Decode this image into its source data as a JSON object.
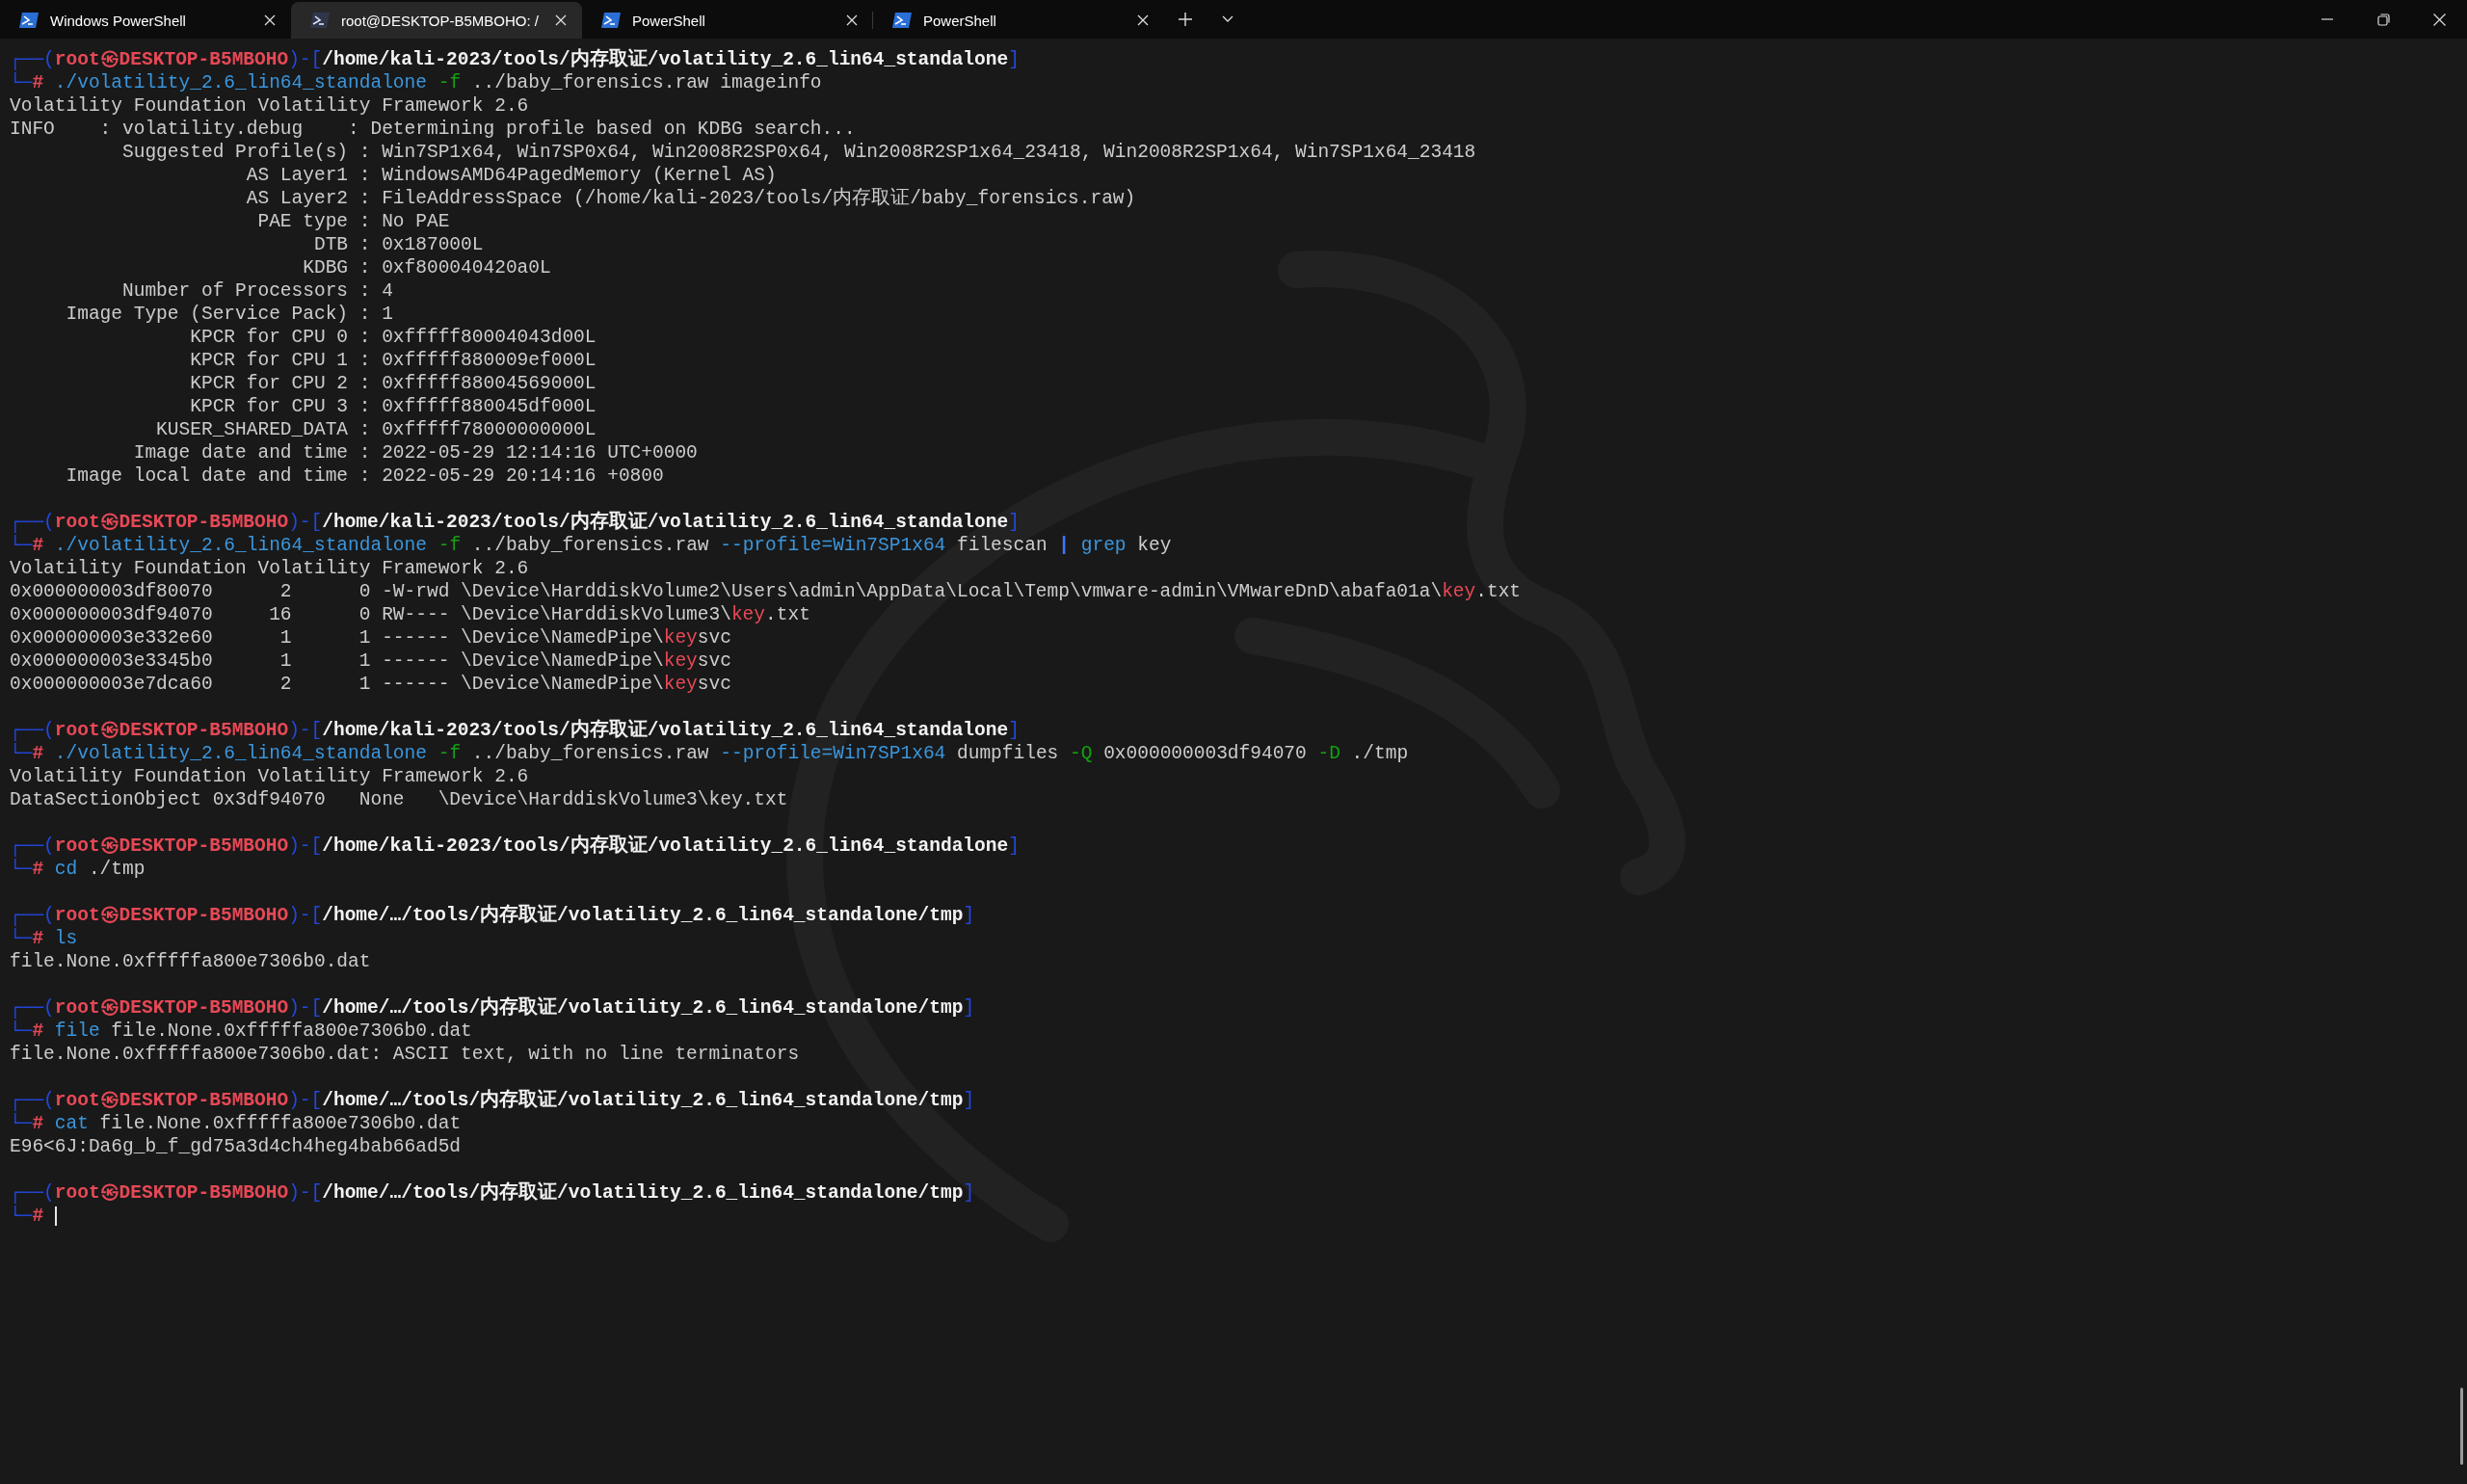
{
  "tabs": [
    {
      "title": "Windows PowerShell",
      "kind": "powershell",
      "selected": false
    },
    {
      "title": "root@DESKTOP-B5MBOHO: /",
      "kind": "terminal",
      "selected": true
    },
    {
      "title": "PowerShell",
      "kind": "powershell",
      "selected": false
    },
    {
      "title": "PowerShell",
      "kind": "powershell",
      "selected": false
    }
  ],
  "terminal": {
    "lines": [
      {
        "segments": [
          {
            "text": "┌──(",
            "kind": "frame"
          },
          {
            "text": "root㉿DESKTOP-B5MBOHO",
            "kind": "user"
          },
          {
            "text": ")-[",
            "kind": "frame"
          },
          {
            "text": "/home/kali-2023/tools/内存取证/volatility_2.6_lin64_standalone",
            "kind": "path"
          },
          {
            "text": "]",
            "kind": "frame"
          }
        ]
      },
      {
        "segments": [
          {
            "text": "└─",
            "kind": "frame"
          },
          {
            "text": "#",
            "kind": "user"
          },
          {
            "text": " ./volatility_2.6_lin64_standalone",
            "kind": "command"
          },
          {
            "text": " -f",
            "kind": "option"
          },
          {
            "text": " ../baby_forensics.raw imageinfo",
            "kind": "plain"
          }
        ]
      },
      {
        "segments": [
          {
            "text": "Volatility Foundation Volatility Framework 2.6",
            "kind": "plain"
          }
        ]
      },
      {
        "segments": [
          {
            "text": "INFO    : volatility.debug    : Determining profile based on KDBG search...",
            "kind": "plain"
          }
        ]
      },
      {
        "segments": [
          {
            "text": "          Suggested Profile(s) : Win7SP1x64, Win7SP0x64, Win2008R2SP0x64, Win2008R2SP1x64_23418, Win2008R2SP1x64, Win7SP1x64_23418",
            "kind": "plain"
          }
        ]
      },
      {
        "segments": [
          {
            "text": "                     AS Layer1 : WindowsAMD64PagedMemory (Kernel AS)",
            "kind": "plain"
          }
        ]
      },
      {
        "segments": [
          {
            "text": "                     AS Layer2 : FileAddressSpace (/home/kali-2023/tools/内存取证/baby_forensics.raw)",
            "kind": "plain"
          }
        ]
      },
      {
        "segments": [
          {
            "text": "                      PAE type : No PAE",
            "kind": "plain"
          }
        ]
      },
      {
        "segments": [
          {
            "text": "                           DTB : 0x187000L",
            "kind": "plain"
          }
        ]
      },
      {
        "segments": [
          {
            "text": "                          KDBG : 0xf800040420a0L",
            "kind": "plain"
          }
        ]
      },
      {
        "segments": [
          {
            "text": "          Number of Processors : 4",
            "kind": "plain"
          }
        ]
      },
      {
        "segments": [
          {
            "text": "     Image Type (Service Pack) : 1",
            "kind": "plain"
          }
        ]
      },
      {
        "segments": [
          {
            "text": "                KPCR for CPU 0 : 0xfffff80004043d00L",
            "kind": "plain"
          }
        ]
      },
      {
        "segments": [
          {
            "text": "                KPCR for CPU 1 : 0xfffff880009ef000L",
            "kind": "plain"
          }
        ]
      },
      {
        "segments": [
          {
            "text": "                KPCR for CPU 2 : 0xfffff88004569000L",
            "kind": "plain"
          }
        ]
      },
      {
        "segments": [
          {
            "text": "                KPCR for CPU 3 : 0xfffff880045df000L",
            "kind": "plain"
          }
        ]
      },
      {
        "segments": [
          {
            "text": "             KUSER_SHARED_DATA : 0xfffff78000000000L",
            "kind": "plain"
          }
        ]
      },
      {
        "segments": [
          {
            "text": "           Image date and time : 2022-05-29 12:14:16 UTC+0000",
            "kind": "plain"
          }
        ]
      },
      {
        "segments": [
          {
            "text": "     Image local date and time : 2022-05-29 20:14:16 +0800",
            "kind": "plain"
          }
        ]
      },
      {
        "blank_before": true,
        "segments": [
          {
            "text": "┌──(",
            "kind": "frame"
          },
          {
            "text": "root㉿DESKTOP-B5MBOHO",
            "kind": "user"
          },
          {
            "text": ")-[",
            "kind": "frame"
          },
          {
            "text": "/home/kali-2023/tools/内存取证/volatility_2.6_lin64_standalone",
            "kind": "path"
          },
          {
            "text": "]",
            "kind": "frame"
          }
        ]
      },
      {
        "segments": [
          {
            "text": "└─",
            "kind": "frame"
          },
          {
            "text": "#",
            "kind": "user"
          },
          {
            "text": " ./volatility_2.6_lin64_standalone",
            "kind": "command"
          },
          {
            "text": " -f",
            "kind": "option"
          },
          {
            "text": " ../baby_forensics.raw ",
            "kind": "plain"
          },
          {
            "text": "--profile=Win7SP1x64",
            "kind": "command"
          },
          {
            "text": " filescan ",
            "kind": "plain"
          },
          {
            "text": "|",
            "kind": "pipe"
          },
          {
            "text": " grep",
            "kind": "command"
          },
          {
            "text": " key",
            "kind": "plain"
          }
        ]
      },
      {
        "segments": [
          {
            "text": "Volatility Foundation Volatility Framework 2.6",
            "kind": "plain"
          }
        ]
      },
      {
        "segments": [
          {
            "text": "0x000000003df80070      2      0 -W-rwd \\Device\\HarddiskVolume2\\Users\\admin\\AppData\\Local\\Temp\\vmware-admin\\VMwareDnD\\abafa01a\\",
            "kind": "plain"
          },
          {
            "text": "key",
            "kind": "match"
          },
          {
            "text": ".txt",
            "kind": "plain"
          }
        ]
      },
      {
        "segments": [
          {
            "text": "0x000000003df94070     16      0 RW---- \\Device\\HarddiskVolume3\\",
            "kind": "plain"
          },
          {
            "text": "key",
            "kind": "match"
          },
          {
            "text": ".txt",
            "kind": "plain"
          }
        ]
      },
      {
        "segments": [
          {
            "text": "0x000000003e332e60      1      1 ------ \\Device\\NamedPipe\\",
            "kind": "plain"
          },
          {
            "text": "key",
            "kind": "match"
          },
          {
            "text": "svc",
            "kind": "plain"
          }
        ]
      },
      {
        "segments": [
          {
            "text": "0x000000003e3345b0      1      1 ------ \\Device\\NamedPipe\\",
            "kind": "plain"
          },
          {
            "text": "key",
            "kind": "match"
          },
          {
            "text": "svc",
            "kind": "plain"
          }
        ]
      },
      {
        "segments": [
          {
            "text": "0x000000003e7dca60      2      1 ------ \\Device\\NamedPipe\\",
            "kind": "plain"
          },
          {
            "text": "key",
            "kind": "match"
          },
          {
            "text": "svc",
            "kind": "plain"
          }
        ]
      },
      {
        "blank_before": true,
        "segments": [
          {
            "text": "┌──(",
            "kind": "frame"
          },
          {
            "text": "root㉿DESKTOP-B5MBOHO",
            "kind": "user"
          },
          {
            "text": ")-[",
            "kind": "frame"
          },
          {
            "text": "/home/kali-2023/tools/内存取证/volatility_2.6_lin64_standalone",
            "kind": "path"
          },
          {
            "text": "]",
            "kind": "frame"
          }
        ]
      },
      {
        "segments": [
          {
            "text": "└─",
            "kind": "frame"
          },
          {
            "text": "#",
            "kind": "user"
          },
          {
            "text": " ./volatility_2.6_lin64_standalone",
            "kind": "command"
          },
          {
            "text": " -f",
            "kind": "option"
          },
          {
            "text": " ../baby_forensics.raw ",
            "kind": "plain"
          },
          {
            "text": "--profile=Win7SP1x64",
            "kind": "command"
          },
          {
            "text": " dumpfiles ",
            "kind": "plain"
          },
          {
            "text": "-Q",
            "kind": "option"
          },
          {
            "text": " 0x000000003df94070 ",
            "kind": "plain"
          },
          {
            "text": "-D",
            "kind": "option"
          },
          {
            "text": " ./tmp",
            "kind": "plain"
          }
        ]
      },
      {
        "segments": [
          {
            "text": "Volatility Foundation Volatility Framework 2.6",
            "kind": "plain"
          }
        ]
      },
      {
        "segments": [
          {
            "text": "DataSectionObject 0x3df94070   None   \\Device\\HarddiskVolume3\\key.txt",
            "kind": "plain"
          }
        ]
      },
      {
        "blank_before": true,
        "segments": [
          {
            "text": "┌──(",
            "kind": "frame"
          },
          {
            "text": "root㉿DESKTOP-B5MBOHO",
            "kind": "user"
          },
          {
            "text": ")-[",
            "kind": "frame"
          },
          {
            "text": "/home/kali-2023/tools/内存取证/volatility_2.6_lin64_standalone",
            "kind": "path"
          },
          {
            "text": "]",
            "kind": "frame"
          }
        ]
      },
      {
        "segments": [
          {
            "text": "└─",
            "kind": "frame"
          },
          {
            "text": "#",
            "kind": "user"
          },
          {
            "text": " cd",
            "kind": "command"
          },
          {
            "text": " ./tmp",
            "kind": "plain"
          }
        ]
      },
      {
        "blank_before": true,
        "segments": [
          {
            "text": "┌──(",
            "kind": "frame"
          },
          {
            "text": "root㉿DESKTOP-B5MBOHO",
            "kind": "user"
          },
          {
            "text": ")-[",
            "kind": "frame"
          },
          {
            "text": "/home/…/tools/内存取证/volatility_2.6_lin64_standalone/tmp",
            "kind": "path"
          },
          {
            "text": "]",
            "kind": "frame"
          }
        ]
      },
      {
        "segments": [
          {
            "text": "└─",
            "kind": "frame"
          },
          {
            "text": "#",
            "kind": "user"
          },
          {
            "text": " ls",
            "kind": "command"
          }
        ]
      },
      {
        "segments": [
          {
            "text": "file.None.0xfffffa800e7306b0.dat",
            "kind": "plain"
          }
        ]
      },
      {
        "blank_before": true,
        "segments": [
          {
            "text": "┌──(",
            "kind": "frame"
          },
          {
            "text": "root㉿DESKTOP-B5MBOHO",
            "kind": "user"
          },
          {
            "text": ")-[",
            "kind": "frame"
          },
          {
            "text": "/home/…/tools/内存取证/volatility_2.6_lin64_standalone/tmp",
            "kind": "path"
          },
          {
            "text": "]",
            "kind": "frame"
          }
        ]
      },
      {
        "segments": [
          {
            "text": "└─",
            "kind": "frame"
          },
          {
            "text": "#",
            "kind": "user"
          },
          {
            "text": " file",
            "kind": "command"
          },
          {
            "text": " file.None.0xfffffa800e7306b0.dat",
            "kind": "plain"
          }
        ]
      },
      {
        "segments": [
          {
            "text": "file.None.0xfffffa800e7306b0.dat: ASCII text, with no line terminators",
            "kind": "plain"
          }
        ]
      },
      {
        "blank_before": true,
        "segments": [
          {
            "text": "┌──(",
            "kind": "frame"
          },
          {
            "text": "root㉿DESKTOP-B5MBOHO",
            "kind": "user"
          },
          {
            "text": ")-[",
            "kind": "frame"
          },
          {
            "text": "/home/…/tools/内存取证/volatility_2.6_lin64_standalone/tmp",
            "kind": "path"
          },
          {
            "text": "]",
            "kind": "frame"
          }
        ]
      },
      {
        "segments": [
          {
            "text": "└─",
            "kind": "frame"
          },
          {
            "text": "#",
            "kind": "user"
          },
          {
            "text": " cat",
            "kind": "command"
          },
          {
            "text": " file.None.0xfffffa800e7306b0.dat",
            "kind": "plain"
          }
        ]
      },
      {
        "segments": [
          {
            "text": "E96<6J:Da6g_b_f_gd75a3d4ch4heg4bab66ad5d",
            "kind": "plain"
          }
        ]
      },
      {
        "blank_before": true,
        "segments": [
          {
            "text": "┌──(",
            "kind": "frame"
          },
          {
            "text": "root㉿DESKTOP-B5MBOHO",
            "kind": "user"
          },
          {
            "text": ")-[",
            "kind": "frame"
          },
          {
            "text": "/home/…/tools/内存取证/volatility_2.6_lin64_standalone/tmp",
            "kind": "path"
          },
          {
            "text": "]",
            "kind": "frame"
          }
        ]
      },
      {
        "segments": [
          {
            "text": "└─",
            "kind": "frame"
          },
          {
            "text": "#",
            "kind": "user"
          }
        ],
        "cursor": true
      }
    ]
  }
}
